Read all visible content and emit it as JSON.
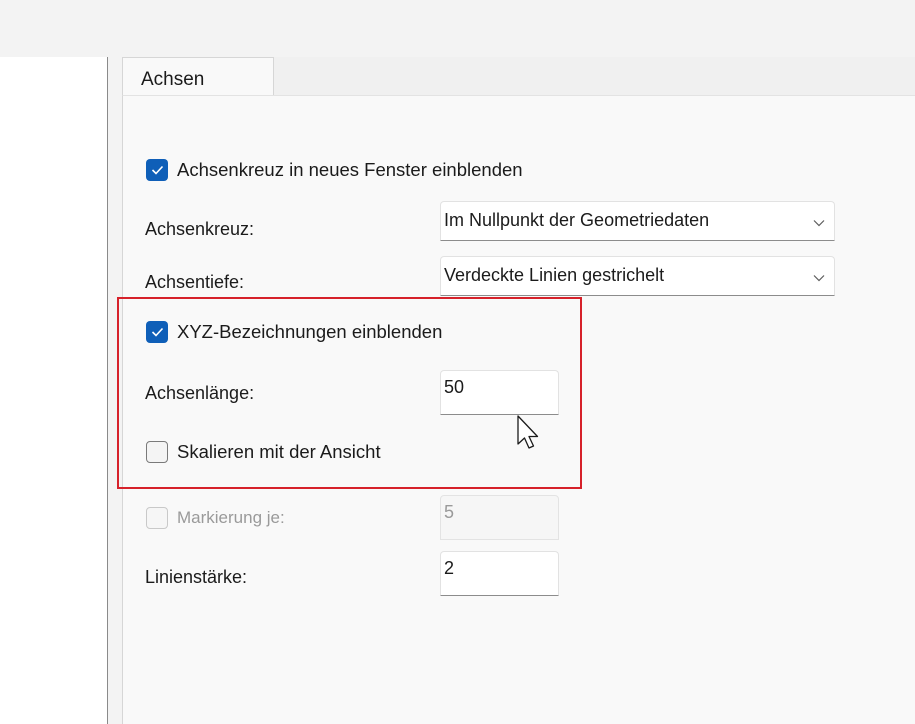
{
  "tab": {
    "label": "Achsen"
  },
  "options": {
    "show_axis_cross": {
      "label": "Achsenkreuz in neues Fenster einblenden",
      "checked": true
    },
    "axis_cross": {
      "label": "Achsenkreuz:",
      "value": "Im Nullpunkt der Geometriedaten"
    },
    "axis_depth": {
      "label": "Achsentiefe:",
      "value": "Verdeckte Linien gestrichelt"
    },
    "show_xyz_labels": {
      "label": "XYZ-Bezeichnungen einblenden",
      "checked": true
    },
    "axis_length": {
      "label": "Achsenlänge:",
      "value": "50"
    },
    "scale_with_view": {
      "label": "Skalieren mit der Ansicht",
      "checked": false
    },
    "marking": {
      "label": "Markierung je:",
      "value": "5",
      "checked": false,
      "disabled": true
    },
    "line_width": {
      "label": "Linienstärke:",
      "value": "2"
    }
  },
  "colors": {
    "accent": "#0f5fb8",
    "highlight": "#d6212a"
  },
  "icons": {
    "checkmark": "check-icon",
    "dropdown": "chevron-down-icon",
    "cursor": "mouse-pointer-icon"
  }
}
